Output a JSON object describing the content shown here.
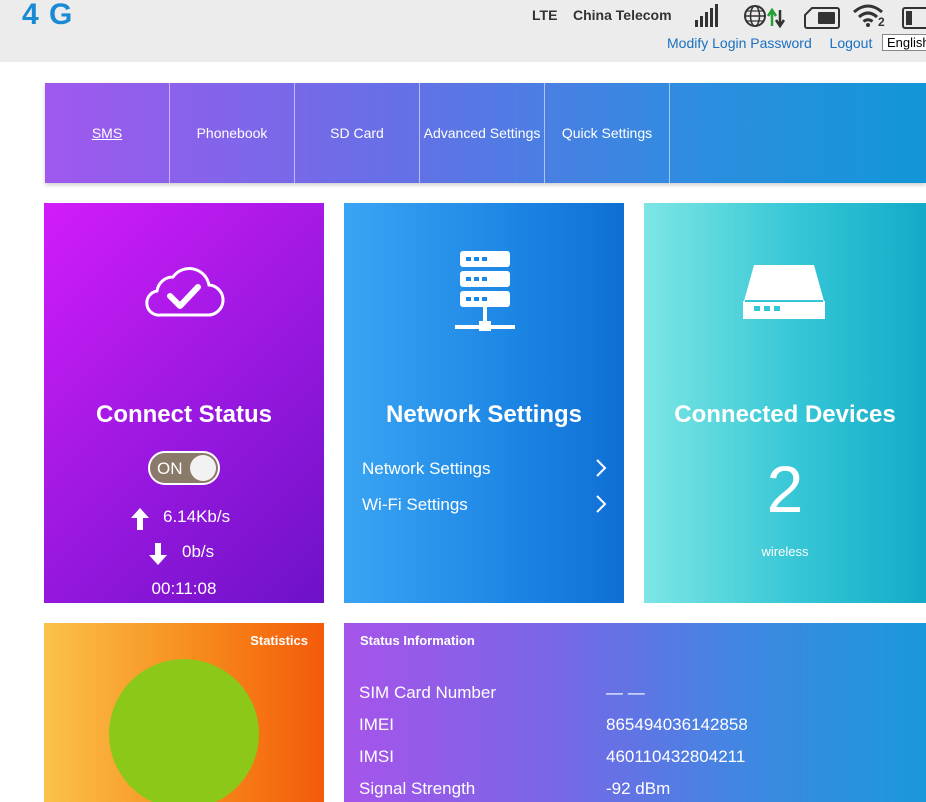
{
  "header": {
    "logo": "4 G",
    "network_type": "LTE",
    "carrier": "China Telecom",
    "wifi_clients": "2",
    "links": {
      "modify_password": "Modify Login Password",
      "logout": "Logout"
    },
    "language": "English"
  },
  "nav": [
    {
      "label": "SMS",
      "active": true
    },
    {
      "label": "Phonebook"
    },
    {
      "label": "SD Card"
    },
    {
      "label": "Advanced Settings"
    },
    {
      "label": "Quick Settings"
    }
  ],
  "connect_card": {
    "title": "Connect Status",
    "toggle_label": "ON",
    "upload": "6.14Kb/s",
    "download": "0b/s",
    "duration": "00:11:08"
  },
  "network_card": {
    "title": "Network Settings",
    "links": [
      "Network Settings",
      "Wi-Fi Settings"
    ]
  },
  "devices_card": {
    "title": "Connected Devices",
    "count": "2",
    "subtitle": "wireless"
  },
  "statistics": {
    "title": "Statistics"
  },
  "status_info": {
    "title": "Status Information",
    "rows": [
      {
        "label": "SIM Card Number",
        "value": "— —"
      },
      {
        "label": "IMEI",
        "value": "865494036142858"
      },
      {
        "label": "IMSI",
        "value": "460110432804211"
      },
      {
        "label": "Signal Strength",
        "value": "-92 dBm"
      }
    ]
  },
  "colors": {
    "logo": "#1a8ad4",
    "connect_card": "#b31ae8",
    "network_card": "#1c86e4",
    "devices_card": "#35c6d6",
    "statistics": "#f78b1c",
    "pie": "#8cc817"
  }
}
